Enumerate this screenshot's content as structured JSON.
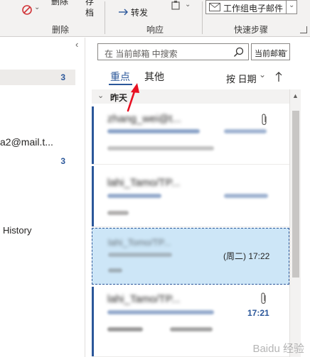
{
  "ribbon": {
    "delete_group": {
      "delete_label": "删除",
      "group_label": "删除"
    },
    "archive_label_1": "存",
    "archive_label_2": "档",
    "respond_group": {
      "forward_label": "转发",
      "group_label": "响应"
    },
    "quicksteps_group": {
      "quickstep_label": "工作组电子邮件",
      "group_label": "快速步骤"
    }
  },
  "folders": {
    "items": [
      {
        "label": "",
        "count": "3"
      },
      {
        "label": "a2@mail.t...",
        "count": "3"
      },
      {
        "label": "History",
        "count": ""
      }
    ]
  },
  "search": {
    "placeholder": "在 当前邮箱 中搜索",
    "scope": "当前邮箱"
  },
  "tabs": {
    "focused": "重点",
    "other": "其他"
  },
  "sort": {
    "label": "按 日期"
  },
  "group_header": {
    "label": "昨天"
  },
  "messages": [
    {
      "sender": "zhang_wei@t...",
      "time": "",
      "has_attachment": true,
      "unread": true
    },
    {
      "sender": "lahi_Tamo/TP...",
      "time": "",
      "has_attachment": false,
      "unread": true
    },
    {
      "sender": "lahi_Tomo/TP...",
      "time": "(周二) 17:22",
      "has_attachment": false,
      "unread": false,
      "selected": true
    },
    {
      "sender": "lahi_Tamo/TP...",
      "time": "17:21",
      "has_attachment": true,
      "unread": true
    }
  ],
  "watermark": "Baidu 经验",
  "colors": {
    "accent": "#2b579a",
    "selected_bg": "#cde6f7",
    "arrow": "#e81123"
  }
}
